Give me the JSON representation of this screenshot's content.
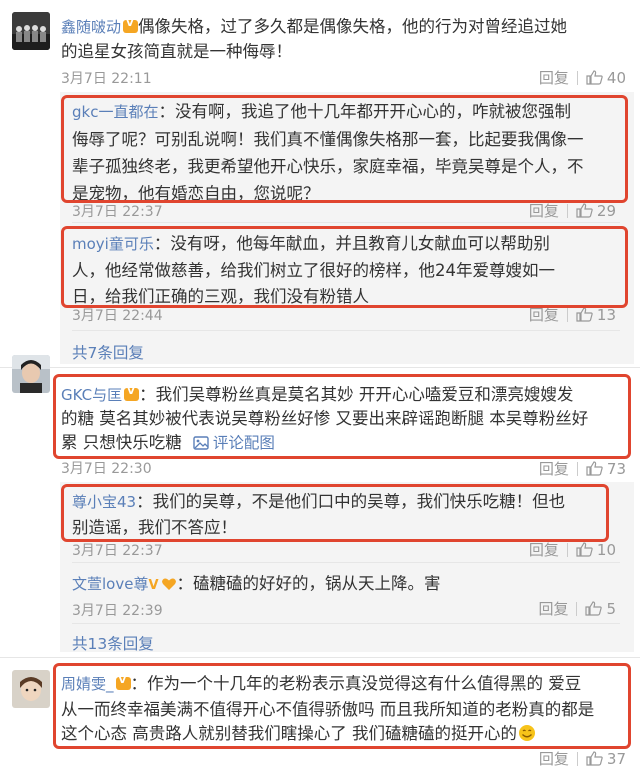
{
  "ui": {
    "reply": "回复"
  },
  "c1": {
    "name": "鑫随啵动",
    "line1": "偶像失格，过了多久都是偶像失格，他的行为对曾经追过她",
    "line2": "的追星女孩简直就是一种侮辱！",
    "time": "3月7日 22:11",
    "likes": "40",
    "r1": {
      "name": "gkc一直都在",
      "line1": "：没有啊，我追了他十几年都开开心心的，咋就被您强制",
      "line2": "侮辱了呢？可别乱说啊！我们真不懂偶像失格那一套，比起要我偶像一",
      "line3": "辈子孤独终老，我更希望他开心快乐，家庭幸福，毕竟吴尊是个人，不",
      "line4": "是宠物，他有婚恋自由，您说呢？",
      "time": "3月7日 22:37",
      "likes": "29"
    },
    "r2": {
      "name": "moyi童可乐",
      "line1": "：没有呀，他每年献血，并且教育儿女献血可以帮助别",
      "line2": "人，他经常做慈善，给我们树立了很好的榜样，他24年爱尊嫂如一",
      "line3": "日，给我们正确的三观，我们没有粉错人",
      "time": "3月7日 22:44",
      "likes": "13"
    },
    "more": "共7条回复"
  },
  "c2": {
    "name": "GKC与匡",
    "line1": "：我们吴尊粉丝真是莫名其妙 开开心心嗑爱豆和漂亮嫂嫂发",
    "line2": "的糖 莫名其妙被代表说吴尊粉丝好惨 又要出来辟谣跑断腿 本吴尊粉丝好",
    "line3": "累 只想快乐吃糖",
    "pics": "评论配图",
    "time": "3月7日 22:30",
    "likes": "73",
    "r1": {
      "name": "尊小宝43",
      "line1": "：我们的吴尊，不是他们口中的吴尊，我们快乐吃糖！但也",
      "line2": "别造谣，我们不答应！",
      "time": "3月7日 22:37",
      "likes": "10"
    },
    "r2": {
      "name": "文萱love尊",
      "line1": "：磕糖磕的好好的，锅从天上降。害",
      "time": "3月7日 22:39",
      "likes": "5"
    },
    "more": "共13条回复"
  },
  "c3": {
    "name": "周婧雯_",
    "line1": "：作为一个十几年的老粉表示真没觉得这有什么值得黑的 爱豆",
    "line2": "从一而终幸福美满不值得开心不值得骄傲吗 而且我所知道的老粉真的都是",
    "line3": "这个心态 高贵路人就别替我们瞎操心了 我们磕糖磕的挺开心的",
    "likes": "37"
  }
}
